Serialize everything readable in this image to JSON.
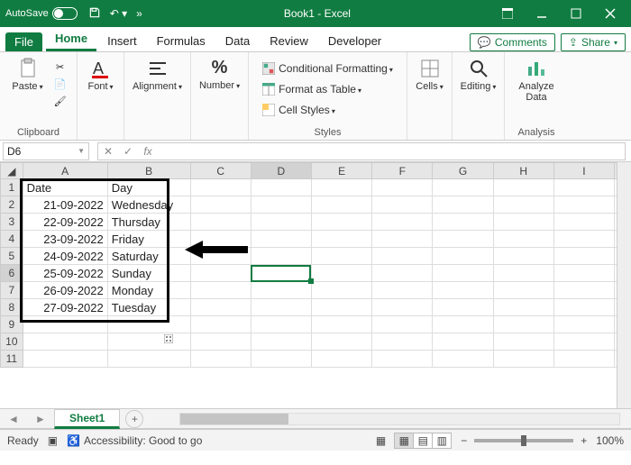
{
  "titlebar": {
    "autosave": "AutoSave",
    "doc_title": "Book1 - Excel"
  },
  "tabs": {
    "file": "File",
    "home": "Home",
    "insert": "Insert",
    "formulas": "Formulas",
    "data": "Data",
    "review": "Review",
    "developer": "Developer",
    "comments": "Comments",
    "share": "Share"
  },
  "ribbon": {
    "clipboard": {
      "paste": "Paste",
      "label": "Clipboard"
    },
    "font": {
      "btn": "Font"
    },
    "alignment": {
      "btn": "Alignment"
    },
    "number": {
      "btn": "Number",
      "symbol": "%"
    },
    "styles": {
      "cond": "Conditional Formatting",
      "table": "Format as Table",
      "cell": "Cell Styles",
      "label": "Styles"
    },
    "cells": {
      "btn": "Cells"
    },
    "editing": {
      "btn": "Editing"
    },
    "analysis": {
      "btn": "Analyze Data",
      "label": "Analysis"
    }
  },
  "namebox": "D6",
  "formula": "",
  "columns": [
    "A",
    "B",
    "C",
    "D",
    "E",
    "F",
    "G",
    "H",
    "I"
  ],
  "rows": [
    {
      "r": "1",
      "A": "Date",
      "B": "Day"
    },
    {
      "r": "2",
      "A": "21-09-2022",
      "B": "Wednesday"
    },
    {
      "r": "3",
      "A": "22-09-2022",
      "B": "Thursday"
    },
    {
      "r": "4",
      "A": "23-09-2022",
      "B": "Friday"
    },
    {
      "r": "5",
      "A": "24-09-2022",
      "B": "Saturday"
    },
    {
      "r": "6",
      "A": "25-09-2022",
      "B": "Sunday"
    },
    {
      "r": "7",
      "A": "26-09-2022",
      "B": "Monday"
    },
    {
      "r": "8",
      "A": "27-09-2022",
      "B": "Tuesday"
    },
    {
      "r": "9"
    },
    {
      "r": "10"
    },
    {
      "r": "11"
    }
  ],
  "selected_cell": "D6",
  "sheet": {
    "name": "Sheet1"
  },
  "status": {
    "ready": "Ready",
    "accessibility": "Accessibility: Good to go",
    "zoom": "100%"
  }
}
